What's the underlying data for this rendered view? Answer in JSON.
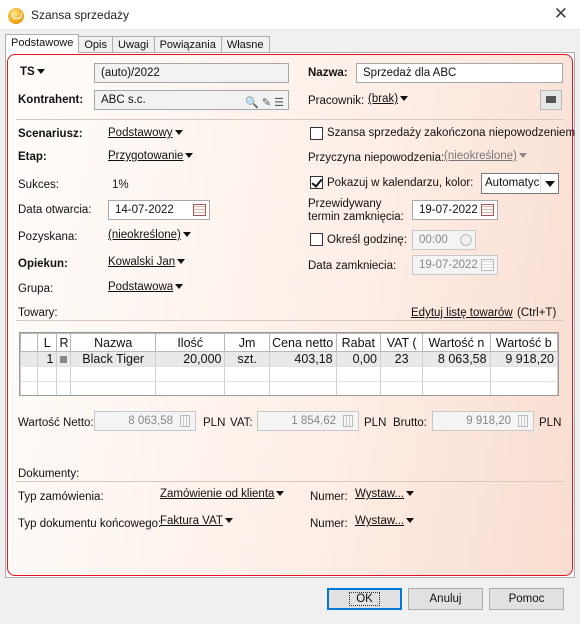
{
  "window": {
    "title": "Szansa sprzedaży",
    "close_glyph": "✕"
  },
  "tabs": [
    {
      "label": "Podstawowe",
      "active": true
    },
    {
      "label": "Opis"
    },
    {
      "label": "Uwagi"
    },
    {
      "label": "Powiązania"
    },
    {
      "label": "Własne"
    }
  ],
  "header": {
    "ts_label": "TS",
    "number_value": "(auto)/2022",
    "nazwa_label": "Nazwa:",
    "nazwa_value": "Sprzedaż dla ABC",
    "kontrahent_label": "Kontrahent:",
    "kontrahent_value": "ABC s.c.",
    "pracownik_label": "Pracownik:",
    "pracownik_value": "(brak)"
  },
  "left": {
    "scenariusz_label": "Scenariusz:",
    "scenariusz_value": "Podstawowy",
    "etap_label": "Etap:",
    "etap_value": "Przygotowanie",
    "sukces_label": "Sukces:",
    "sukces_value": "1%",
    "data_otwarcia_label": "Data otwarcia:",
    "data_otwarcia_value": "14-07-2022",
    "pozyskana_label": "Pozyskana:",
    "pozyskana_value": "(nieokreślone)",
    "opiekun_label": "Opiekun:",
    "opiekun_value": "Kowalski Jan",
    "grupa_label": "Grupa:",
    "grupa_value": "Podstawowa"
  },
  "right": {
    "zakonczona_label": "Szansa sprzedaży zakończona niepowodzeniem",
    "zakonczona_checked": false,
    "przyczyna_label": "Przyczyna niepowodzenia:",
    "przyczyna_value": "(nieokreślone)",
    "kalendarz_label": "Pokazuj w kalendarzu, kolor:",
    "kalendarz_checked": true,
    "kolor_value": "Automatyczny",
    "przewidywany_label_1": "Przewidywany",
    "przewidywany_label_2": "termin zamknięcia:",
    "przewidywany_value": "19-07-2022",
    "godzine_label": "Określ godzinę:",
    "godzine_checked": false,
    "godzine_value": "00:00",
    "data_zamkniecia_label": "Data zamkniecia:",
    "data_zamkniecia_value": "19-07-2022"
  },
  "towary": {
    "label": "Towary:",
    "edit_link": "Edytuj listę towarów",
    "edit_shortcut": "(Ctrl+T)",
    "columns": [
      "L",
      "R",
      "Nazwa",
      "Ilość",
      "Jm",
      "Cena netto",
      "Rabat",
      "VAT (",
      "Wartość n",
      "Wartość b"
    ],
    "rows": [
      {
        "l": "1",
        "nazwa": "Black Tiger",
        "ilosc": "20,000",
        "jm": "szt.",
        "cena": "403,18",
        "rabat": "0,00",
        "vat": "23",
        "wnetto": "8 063,58",
        "wbrutto": "9 918,20"
      }
    ]
  },
  "totals": {
    "netto_label": "Wartość Netto:",
    "netto_value": "8 063,58",
    "vat_label": "VAT:",
    "vat_value": "1 854,62",
    "brutto_label": "Brutto:",
    "brutto_value": "9 918,20",
    "currency": "PLN"
  },
  "dokumenty": {
    "label": "Dokumenty:",
    "typ_zam_label": "Typ zamówienia:",
    "typ_zam_value": "Zamówienie od klienta",
    "typ_konc_label": "Typ dokumentu końcowego:",
    "typ_konc_value": "Faktura VAT",
    "numer_label": "Numer:",
    "numer_value_1": "Wystaw...",
    "numer_value_2": "Wystaw..."
  },
  "buttons": {
    "ok": "OK",
    "cancel": "Anuluj",
    "help": "Pomoc"
  },
  "colors": {
    "accent_border": "#e81123",
    "default_button": "#0078d7"
  }
}
